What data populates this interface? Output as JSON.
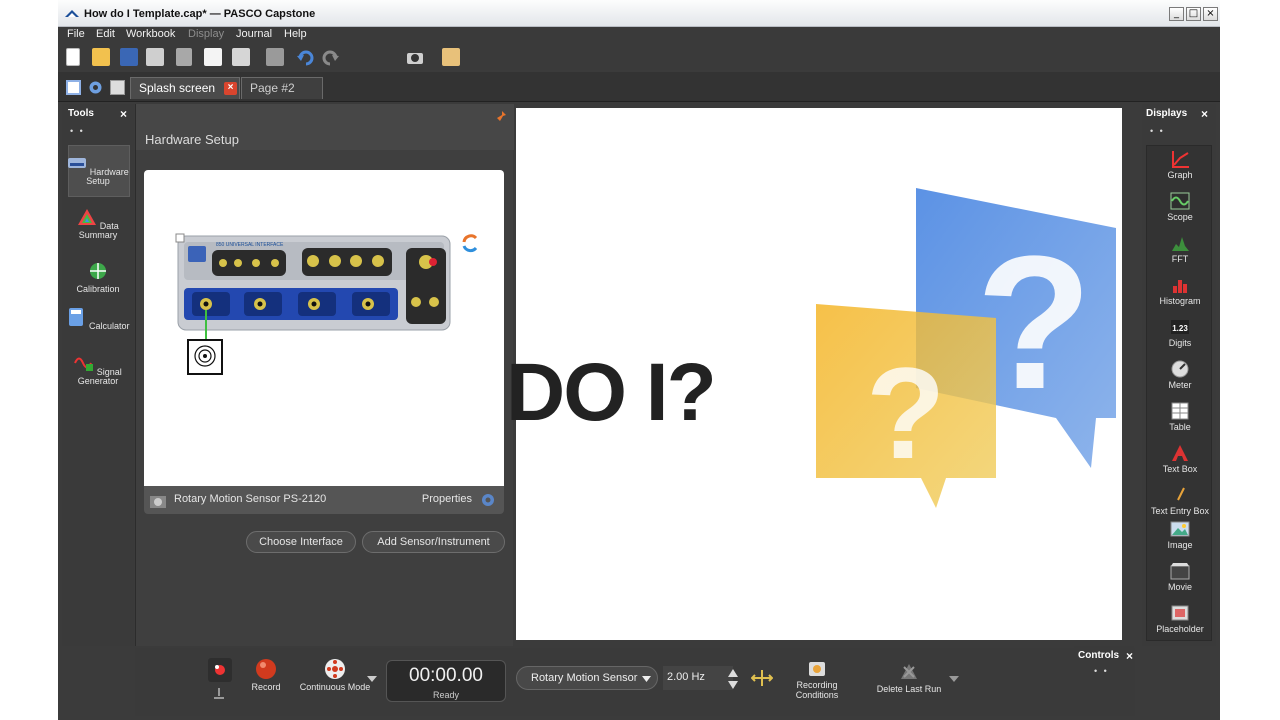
{
  "window": {
    "title": "How do I Template.cap* — PASCO Capstone",
    "controls": [
      "_",
      "□",
      "×"
    ]
  },
  "menu": [
    {
      "label": "File",
      "enabled": true
    },
    {
      "label": "Edit",
      "enabled": true
    },
    {
      "label": "Workbook",
      "enabled": true
    },
    {
      "label": "Display",
      "enabled": false
    },
    {
      "label": "Journal",
      "enabled": true
    },
    {
      "label": "Help",
      "enabled": true
    }
  ],
  "tabs": [
    {
      "label": "Splash screen",
      "active": true
    },
    {
      "label": "Page #2",
      "active": false
    }
  ],
  "tools": {
    "title": "Tools",
    "close": "×",
    "dots": "• •",
    "items": [
      {
        "label": "Hardware Setup",
        "selected": true
      },
      {
        "label": "Data Summary"
      },
      {
        "label": "Calibration"
      },
      {
        "label": "Calculator"
      },
      {
        "label": "Signal Generator"
      }
    ]
  },
  "hardware": {
    "title": "Hardware Setup",
    "interface_label": "850 UNIVERSAL INTERFACE",
    "sensor_name": "Rotary Motion Sensor PS-2120",
    "properties": "Properties",
    "choose_interface": "Choose Interface",
    "add_sensor": "Add Sensor/Instrument"
  },
  "page": {
    "big_text": "DO I?"
  },
  "displays": {
    "title": "Displays",
    "close": "×",
    "dots": "• •",
    "items": [
      {
        "label": "Graph",
        "icon": "graph-icon"
      },
      {
        "label": "Scope",
        "icon": "scope-icon"
      },
      {
        "label": "FFT",
        "icon": "fft-icon"
      },
      {
        "label": "Histogram",
        "icon": "histogram-icon"
      },
      {
        "label": "Digits",
        "icon": "digits-icon",
        "glyph": "1.23"
      },
      {
        "label": "Meter",
        "icon": "meter-icon"
      },
      {
        "label": "Table",
        "icon": "table-icon"
      },
      {
        "label": "Text Box",
        "icon": "text-box-icon"
      },
      {
        "label": "Text Entry Box",
        "icon": "text-entry-box-icon"
      },
      {
        "label": "Image",
        "icon": "image-icon"
      },
      {
        "label": "Movie",
        "icon": "movie-icon"
      },
      {
        "label": "Placeholder",
        "icon": "placeholder-icon"
      }
    ]
  },
  "controls": {
    "title": "Controls",
    "close": "×",
    "dots": "• •",
    "record": "Record",
    "mode": "Continuous Mode",
    "time": "00:00.00",
    "status": "Ready",
    "sensor": "Rotary Motion Sensor",
    "rate": "2.00 Hz",
    "recording_conditions": "Recording Conditions",
    "delete_last_run": "Delete Last Run"
  },
  "colors": {
    "accent_red": "#d9452e",
    "bubble_blue": "#4a86d8",
    "bubble_yellow": "#f0b429",
    "panel_bg": "#3b3b3b"
  }
}
